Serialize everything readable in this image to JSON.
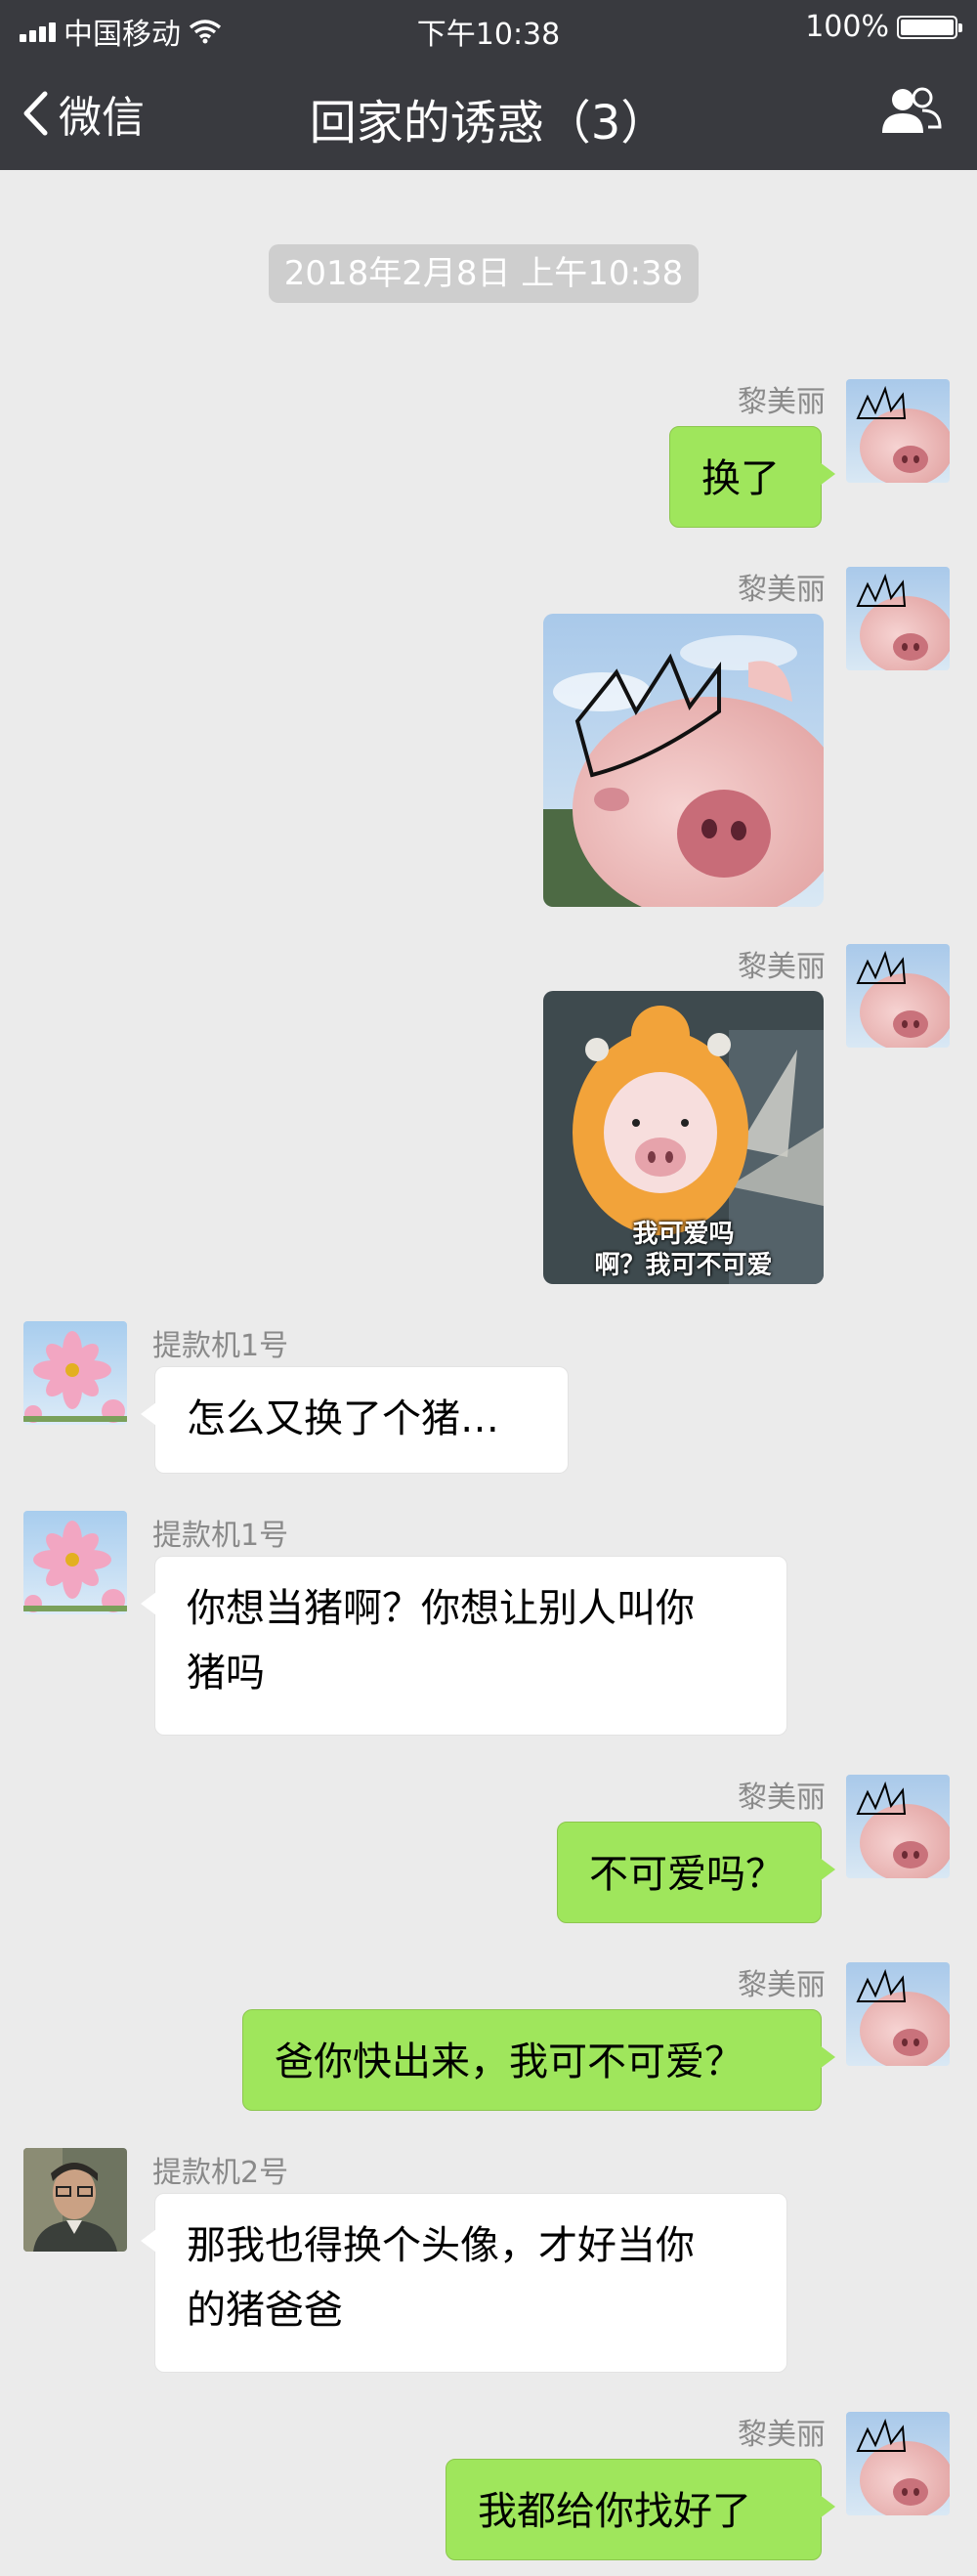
{
  "status_bar": {
    "carrier": "中国移动",
    "time": "下午10:38",
    "battery": "100%"
  },
  "nav": {
    "back_label": "微信",
    "title": "回家的诱惑（3）"
  },
  "timestamp": "2018年2月8日 上午10:38",
  "messages": [
    {
      "sender": "黎美丽",
      "side": "right",
      "text": "换了"
    },
    {
      "sender": "黎美丽",
      "side": "right",
      "image": "pig-with-crown"
    },
    {
      "sender": "黎美丽",
      "side": "right",
      "image": "pig-in-costume",
      "caption_line1": "我可爱吗",
      "caption_line2": "啊？我可不可爱"
    },
    {
      "sender": "提款机1号",
      "side": "left",
      "text": "怎么又换了个猪…"
    },
    {
      "sender": "提款机1号",
      "side": "left",
      "text_line1": "你想当猪啊？你想让别人叫你",
      "text_line2": "猪吗"
    },
    {
      "sender": "黎美丽",
      "side": "right",
      "text": "不可爱吗？"
    },
    {
      "sender": "黎美丽",
      "side": "right",
      "text": "爸你快出来，我可不可爱？"
    },
    {
      "sender": "提款机2号",
      "side": "left",
      "text_line1": "那我也得换个头像，才好当你",
      "text_line2": "的猪爸爸"
    },
    {
      "sender": "黎美丽",
      "side": "right",
      "text": "我都给你找好了"
    }
  ],
  "colors": {
    "nav_bg": "#393a3f",
    "chat_bg": "#ebebeb",
    "right_bubble": "#9fe65c",
    "left_bubble": "#ffffff"
  }
}
